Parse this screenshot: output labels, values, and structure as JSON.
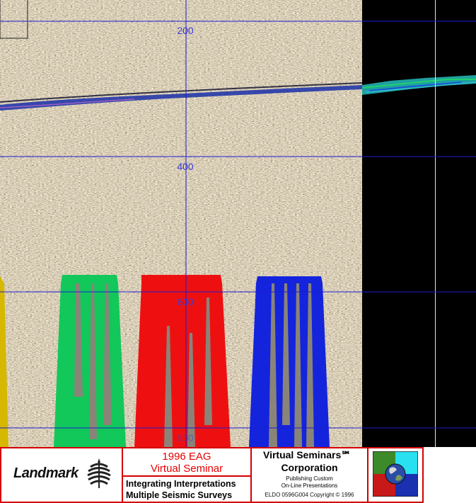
{
  "seismic_view": {
    "depth_labels": [
      {
        "text": "200"
      },
      {
        "text": "400"
      },
      {
        "text": "600"
      },
      {
        "text": "800"
      }
    ],
    "colors": {
      "grid": "#1c1cd0",
      "label": "#3a3ad8",
      "background": "#000000",
      "well_green": "#12c85a",
      "well_red": "#ee1010",
      "well_blue": "#1424dc",
      "well_yellow": "#d6b800",
      "horizon": "#1a2fa8",
      "surface": "#1fa0a0"
    }
  },
  "footer": {
    "landmark_logo": "Landmark",
    "seminar_year": "1996 EAG",
    "seminar_title": "Virtual Seminar",
    "topic_line1": "Integrating Interpretations",
    "topic_line2": "Multiple Seismic Surveys",
    "company_line1": "Virtual Seminars℠",
    "company_line2": "Corporation",
    "publishing_line1": "Publishing Custom",
    "publishing_line2": "On-Line Presentations",
    "copyright": "ELDO 0596G004 Copyright © 1996",
    "colors": {
      "border": "#d40000",
      "accent_text": "#e60000"
    }
  }
}
